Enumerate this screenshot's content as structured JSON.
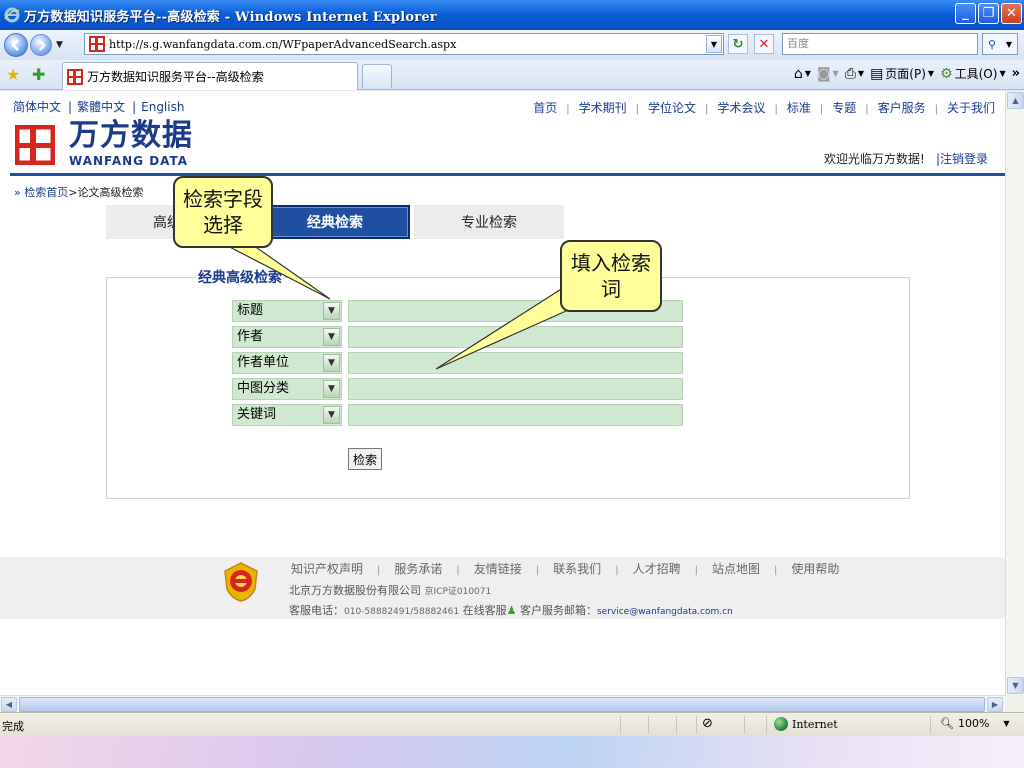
{
  "window": {
    "title": "万方数据知识服务平台--高级检索 - Windows Internet Explorer",
    "minimize": "_",
    "maximize": "❐",
    "close": "✕"
  },
  "address": {
    "url": "http://s.g.wanfangdata.com.cn/WFpaperAdvancedSearch.aspx",
    "search_placeholder": "百度"
  },
  "tab": {
    "label": "万方数据知识服务平台--高级检索"
  },
  "commandbar": {
    "page": "页面(P)",
    "tools": "工具(O)"
  },
  "site": {
    "langs": [
      "简体中文",
      "繁體中文",
      "English"
    ],
    "topnav": [
      "首页",
      "学术期刊",
      "学位论文",
      "学术会议",
      "标准",
      "专题",
      "客户服务",
      "关于我们"
    ],
    "brand_cn": "万方数据",
    "brand_en": "WANFANG DATA",
    "welcome": "欢迎光临万方数据!",
    "logout": "|注销登录"
  },
  "breadcrumb": {
    "arrow": "»",
    "home": "检索首页",
    "sep": ">",
    "current": "论文高级检索"
  },
  "search_tabs": [
    {
      "label": "高级检索"
    },
    {
      "label": "经典检索"
    },
    {
      "label": "专业检索"
    }
  ],
  "panel": {
    "title": "经典高级检索",
    "fields": [
      {
        "field": "标题",
        "value": ""
      },
      {
        "field": "作者",
        "value": ""
      },
      {
        "field": "作者单位",
        "value": ""
      },
      {
        "field": "中图分类",
        "value": ""
      },
      {
        "field": "关键词",
        "value": ""
      }
    ],
    "search_button": "检索"
  },
  "callouts": {
    "field_select": "检索字段选择",
    "enter_term": "填入检索词"
  },
  "footer": {
    "links": [
      "知识产权声明",
      "服务承诺",
      "友情链接",
      "联系我们",
      "人才招聘",
      "站点地图",
      "使用帮助"
    ],
    "company": "北京万方数据股份有限公司",
    "icp": "京ICP证010071",
    "phone_label": "客服电话：",
    "phone": "010-58882491/58882461",
    "online_service": "在线客服",
    "email_label": "客户服务邮箱：",
    "email": "service@wanfangdata.com.cn"
  },
  "statusbar": {
    "status": "完成",
    "zone": "Internet",
    "zoom": "100%"
  },
  "colors": {
    "brand_blue": "#1f4fa0",
    "logo_red": "#d7261e",
    "field_green": "#cfe8cf",
    "callout_yellow": "#ffff99"
  }
}
